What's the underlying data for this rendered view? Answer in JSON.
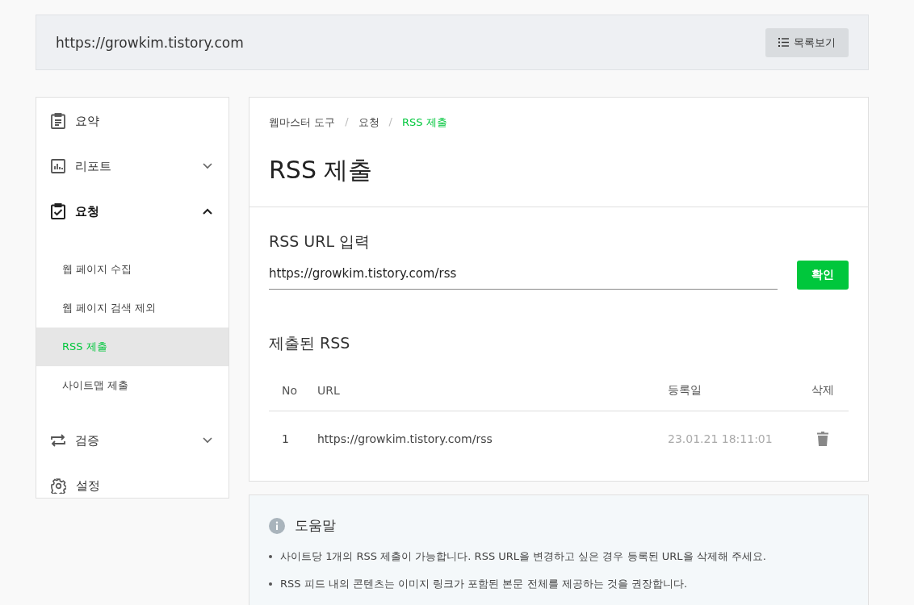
{
  "header": {
    "site_url": "https://growkim.tistory.com",
    "list_button": "목록보기"
  },
  "sidebar": {
    "items": [
      {
        "kind": "link",
        "label": "요약"
      },
      {
        "kind": "group",
        "label": "리포트",
        "expanded": false
      },
      {
        "kind": "group",
        "label": "요청",
        "expanded": true,
        "children": [
          {
            "label": "웹 페이지 수집",
            "selected": false
          },
          {
            "label": "웹 페이지 검색 제외",
            "selected": false
          },
          {
            "label": "RSS 제출",
            "selected": true
          },
          {
            "label": "사이트맵 제출",
            "selected": false
          }
        ]
      },
      {
        "kind": "group",
        "label": "검증",
        "expanded": false
      },
      {
        "kind": "link",
        "label": "설정"
      }
    ]
  },
  "breadcrumb": [
    "웹마스터 도구",
    "요청",
    "RSS 제출"
  ],
  "breadcrumb_separator": "/",
  "page_title": "RSS 제출",
  "rss_input": {
    "label": "RSS URL 입력",
    "value": "https://growkim.tistory.com/rss",
    "button": "확인"
  },
  "submitted": {
    "title": "제출된 RSS",
    "columns": [
      "No",
      "URL",
      "등록일",
      "삭제"
    ],
    "rows": [
      {
        "no": "1",
        "url": "https://growkim.tistory.com/rss",
        "date": "23.01.21 18:11:01"
      }
    ]
  },
  "help": {
    "title": "도움말",
    "items": [
      "사이트당 1개의 RSS 제출이 가능합니다. RSS URL을 변경하고 싶은 경우 등록된 URL을 삭제해 주세요.",
      "RSS 피드 내의 콘텐츠는 이미지 링크가 포함된 본문 전체를 제공하는 것을 권장합니다."
    ]
  }
}
